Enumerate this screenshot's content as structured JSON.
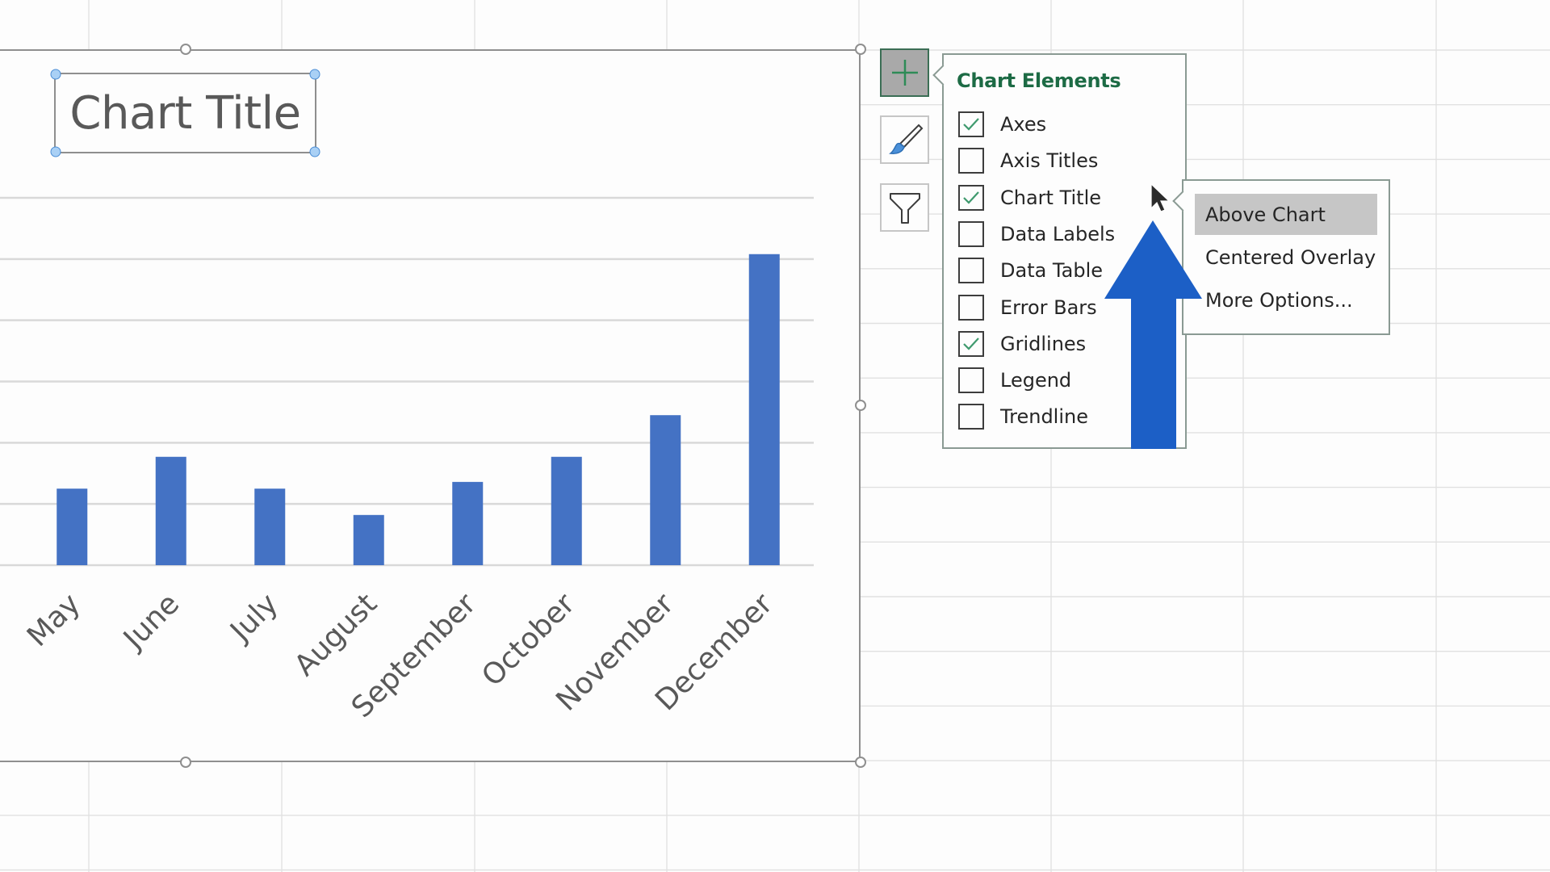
{
  "app": "Microsoft Excel",
  "chart": {
    "title": "Chart Title",
    "bar_color": "#4472c4",
    "gridline_color": "#d9d9d9",
    "axis_label_color": "#595959"
  },
  "chart_data": {
    "type": "bar",
    "title": "Chart Title",
    "categories": [
      "May",
      "June",
      "July",
      "August",
      "September",
      "October",
      "November",
      "December"
    ],
    "values": [
      1.25,
      1.77,
      1.25,
      0.82,
      1.36,
      1.77,
      2.45,
      5.08
    ],
    "value_units": "gridline intervals (y-axis tick labels not visible)",
    "ylim": [
      0,
      6
    ],
    "gridlines": true,
    "legend": "none",
    "xlabel": "",
    "ylabel": "",
    "x_tick_rotation": "-45deg"
  },
  "side_buttons": {
    "elements": "Chart Elements",
    "styles": "Chart Styles",
    "filters": "Chart Filters"
  },
  "elements_panel": {
    "heading": "Chart Elements",
    "accent": "#1d6b45",
    "items": [
      {
        "label": "Axes",
        "checked": true
      },
      {
        "label": "Axis Titles",
        "checked": false
      },
      {
        "label": "Chart Title",
        "checked": true
      },
      {
        "label": "Data Labels",
        "checked": false
      },
      {
        "label": "Data Table",
        "checked": false
      },
      {
        "label": "Error Bars",
        "checked": false
      },
      {
        "label": "Gridlines",
        "checked": true
      },
      {
        "label": "Legend",
        "checked": false
      },
      {
        "label": "Trendline",
        "checked": false
      }
    ]
  },
  "chart_title_submenu": {
    "items": [
      {
        "label": "Above Chart",
        "highlighted": true
      },
      {
        "label": "Centered Overlay",
        "highlighted": false
      },
      {
        "label": "More Options...",
        "highlighted": false
      }
    ]
  },
  "annotation": {
    "arrow_color": "#1c5fc6",
    "arrow_points_to": "Chart Title"
  }
}
